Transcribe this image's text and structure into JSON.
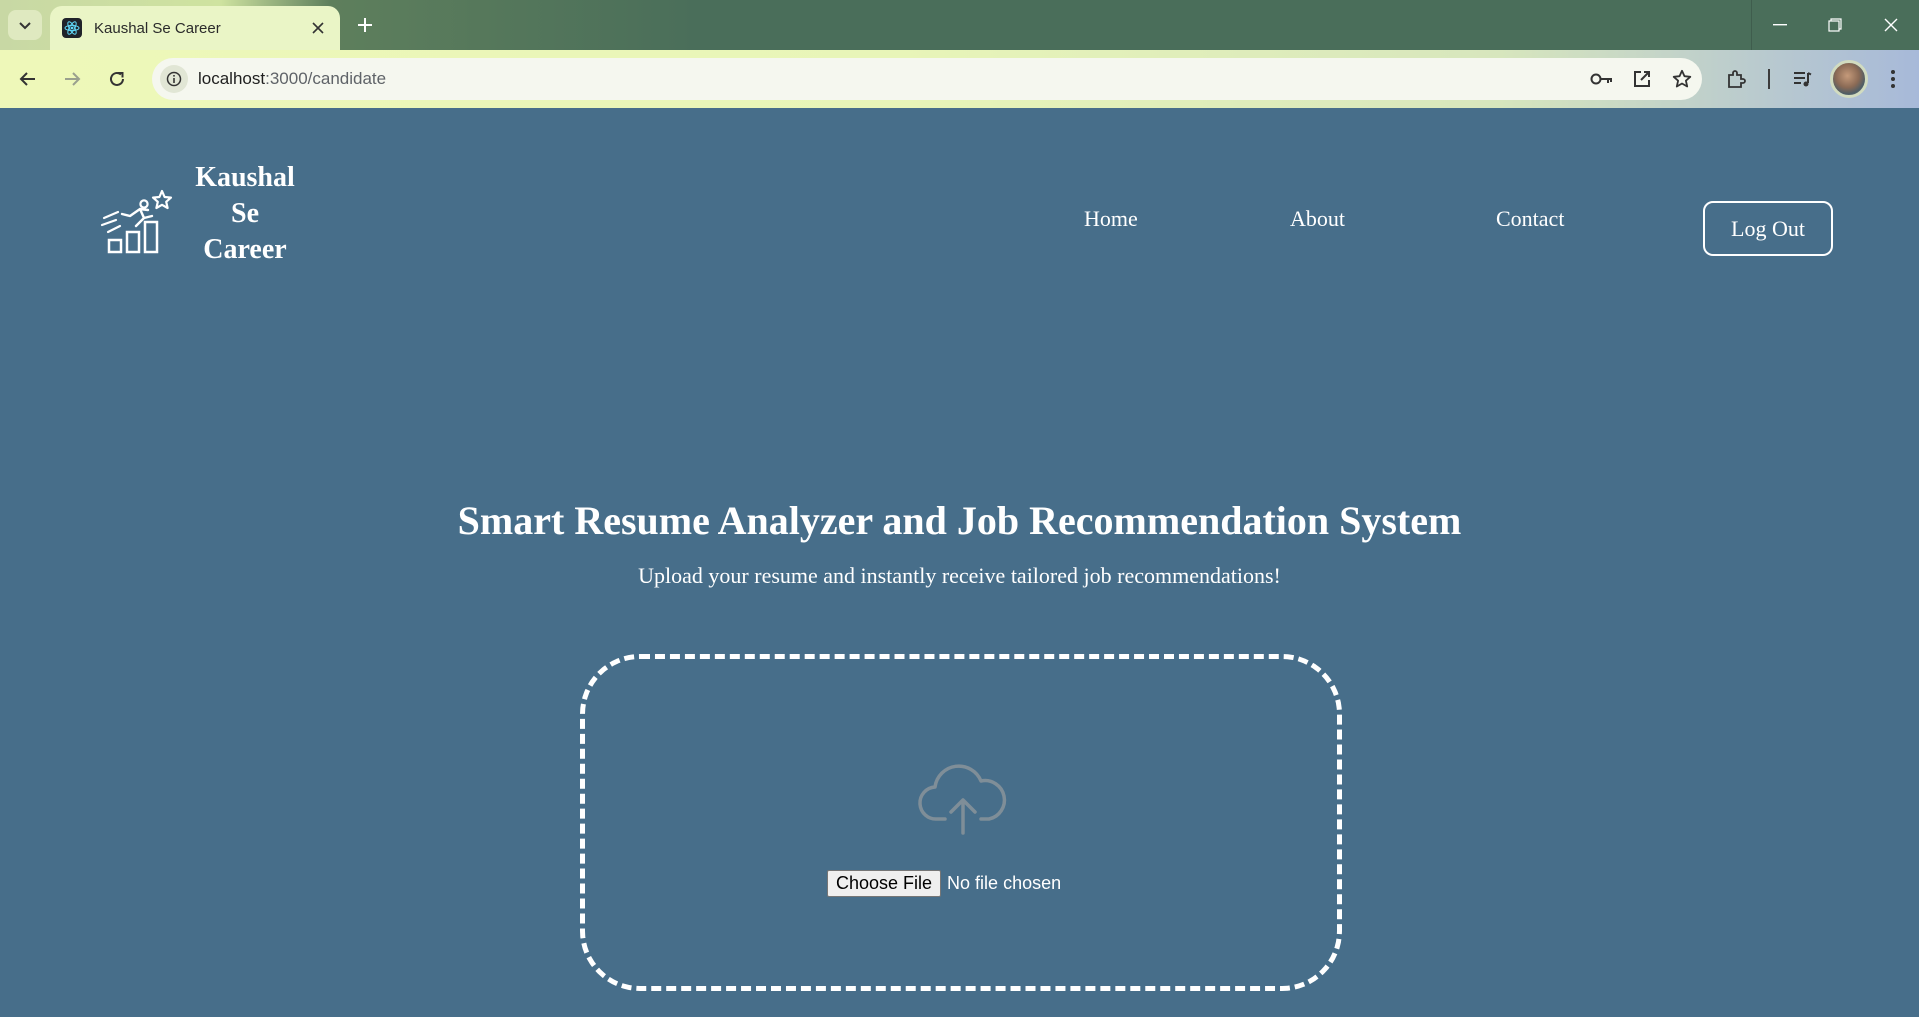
{
  "browser": {
    "tab_title": "Kaushal Se Career",
    "url_host": "localhost",
    "url_path": ":3000/candidate",
    "icons": [
      "tab-search-icon",
      "react-favicon-icon",
      "close-icon",
      "plus-icon",
      "back-arrow-icon",
      "forward-arrow-icon",
      "reload-icon",
      "site-info-icon",
      "key-icon",
      "open-in-new-icon",
      "star-icon",
      "extensions-icon",
      "media-icon",
      "kebab-menu-icon",
      "minimize-icon",
      "restore-icon",
      "window-close-icon"
    ]
  },
  "header": {
    "brand_line1": "Kaushal",
    "brand_line2": "Se",
    "brand_line3": "Career",
    "nav": {
      "home": "Home",
      "about": "About",
      "contact": "Contact"
    },
    "logout": "Log Out"
  },
  "hero": {
    "title": "Smart Resume Analyzer and Job Recommendation System",
    "subtitle": "Upload your resume and instantly receive tailored job recommendations!"
  },
  "upload": {
    "button": "Choose File",
    "status": "No file chosen"
  },
  "colors": {
    "page_bg": "#476e8a",
    "text": "#ffffff",
    "cloud_icon": "#7f8e98"
  }
}
